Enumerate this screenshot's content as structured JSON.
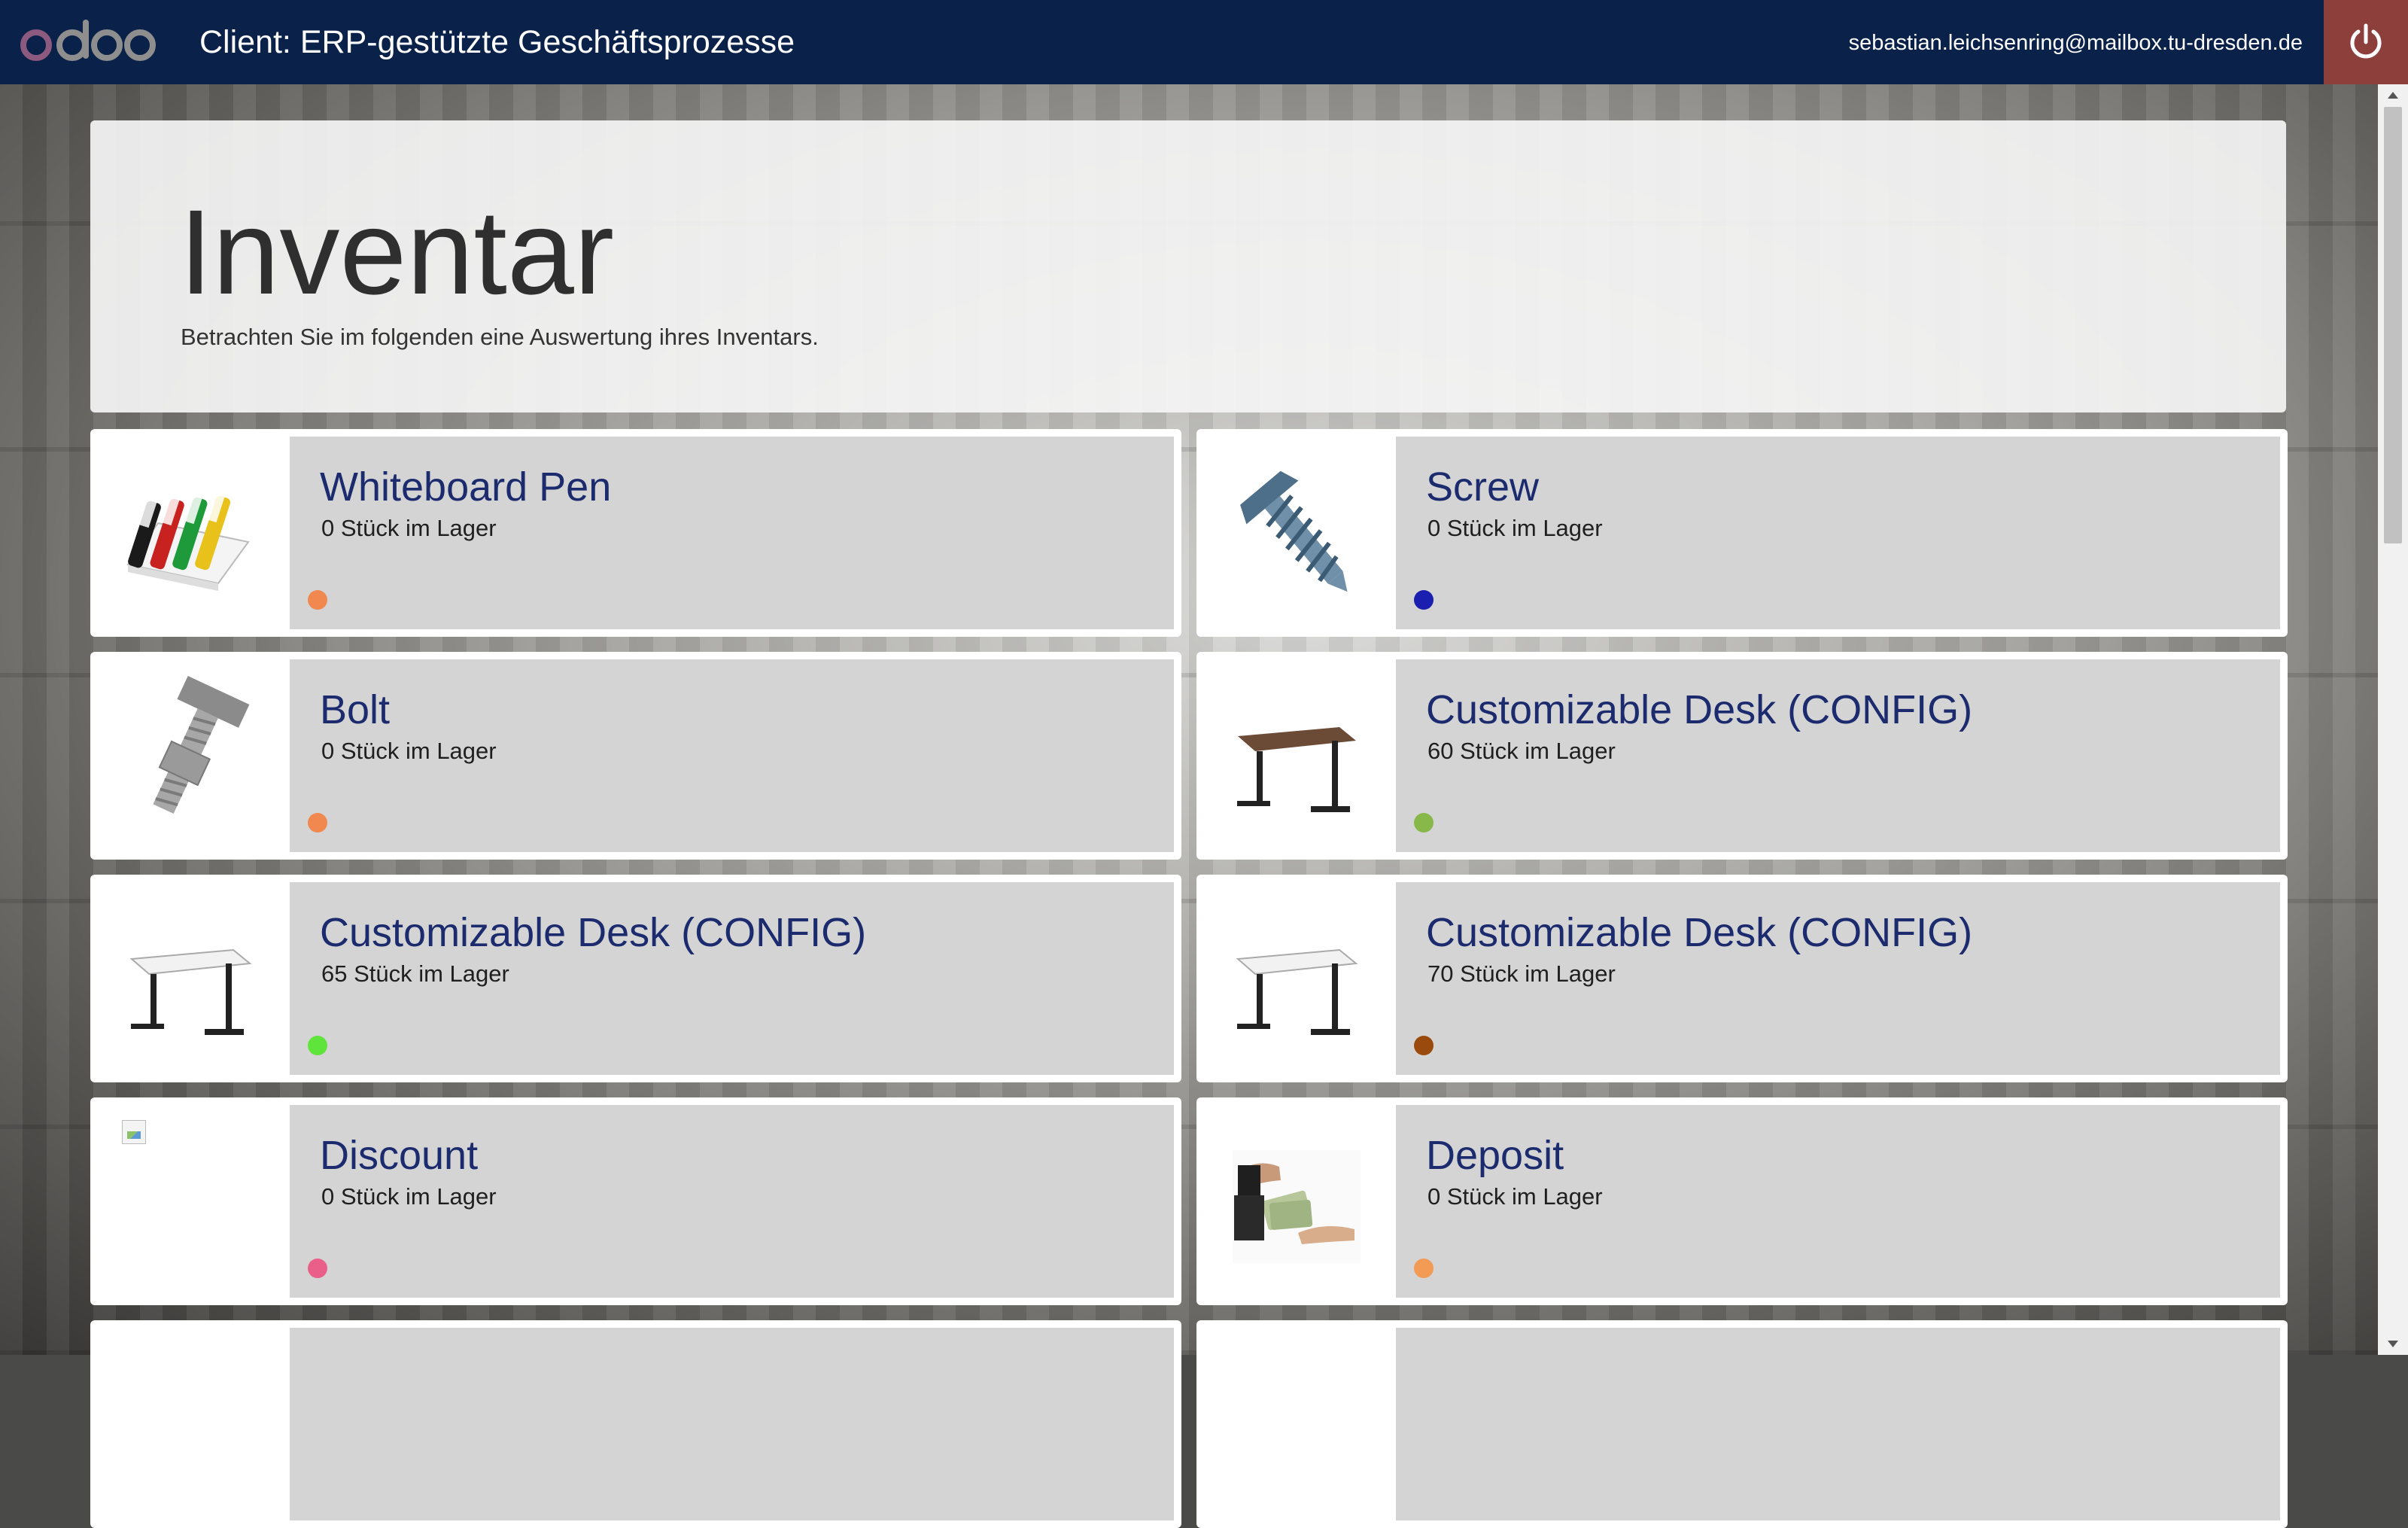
{
  "topbar": {
    "logo_text": "odoo",
    "client_title": "Client: ERP-gestützte Geschäftsprozesse",
    "user_email": "sebastian.leichsenring@mailbox.tu-dresden.de",
    "power_icon": "power-icon"
  },
  "header": {
    "title": "Inventar",
    "subtitle": "Betrachten Sie im folgenden eine Auswertung ihres Inventars."
  },
  "products": [
    {
      "name": "Whiteboard Pen",
      "stock": "0 Stück im Lager",
      "dot_color": "#f0884f",
      "image": "whiteboard-pens"
    },
    {
      "name": "Screw",
      "stock": "0 Stück im Lager",
      "dot_color": "#1a1fb0",
      "image": "screw"
    },
    {
      "name": "Bolt",
      "stock": "0 Stück im Lager",
      "dot_color": "#f0884f",
      "image": "bolt"
    },
    {
      "name": "Customizable Desk (CONFIG)",
      "stock": "60 Stück im Lager",
      "dot_color": "#88b84a",
      "image": "desk-wood"
    },
    {
      "name": "Customizable Desk (CONFIG)",
      "stock": "65 Stück im Lager",
      "dot_color": "#5ee43a",
      "image": "desk-white"
    },
    {
      "name": "Customizable Desk (CONFIG)",
      "stock": "70 Stück im Lager",
      "dot_color": "#9a4a0d",
      "image": "desk-white"
    },
    {
      "name": "Discount",
      "stock": "0 Stück im Lager",
      "dot_color": "#ea5e8a",
      "image": "broken-image"
    },
    {
      "name": "Deposit",
      "stock": "0 Stück im Lager",
      "dot_color": "#f39a55",
      "image": "money-hands"
    }
  ],
  "colors": {
    "topbar": "#0a2149",
    "power_button": "#8d3f3c",
    "product_name": "#1b2b6e"
  }
}
